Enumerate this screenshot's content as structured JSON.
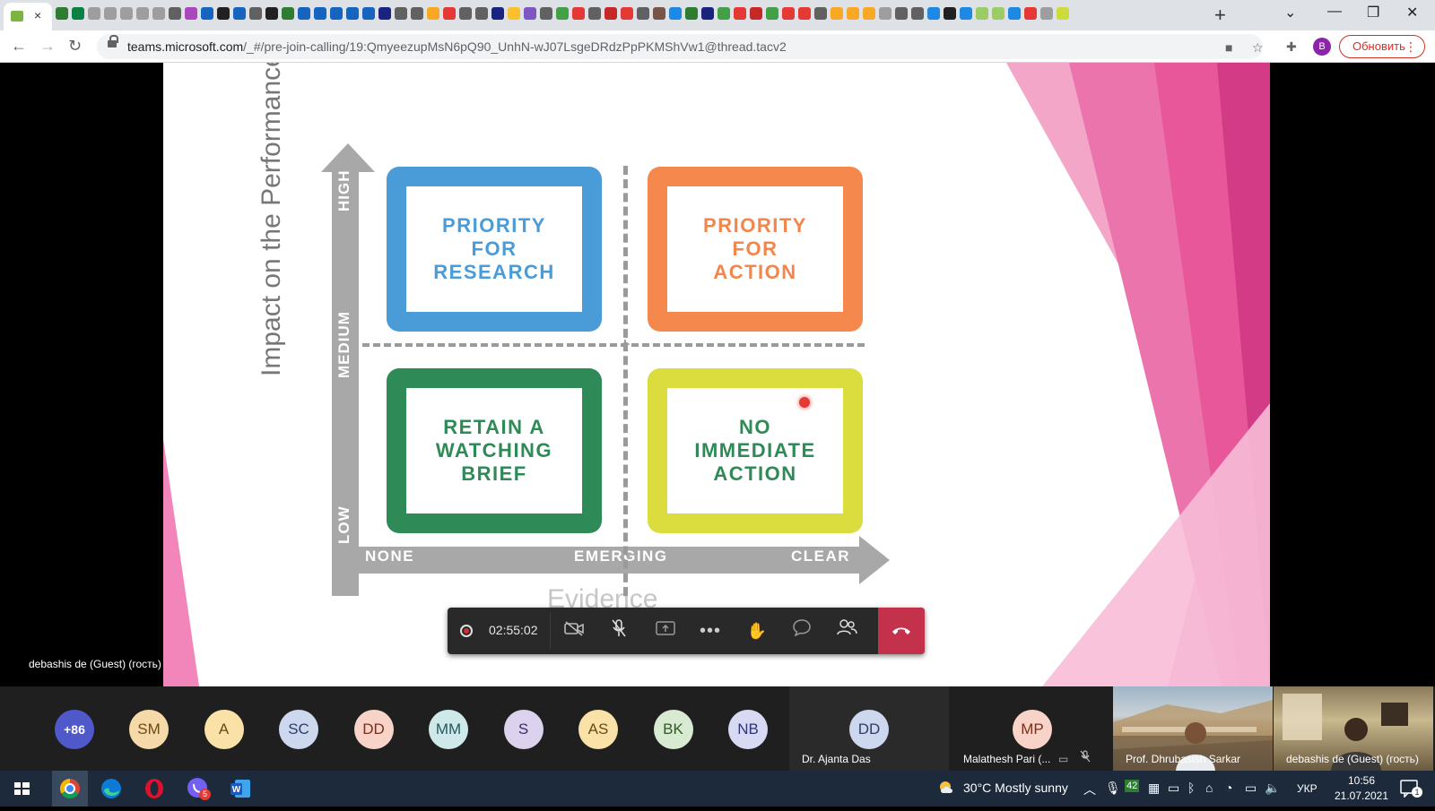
{
  "browser": {
    "close_tab_glyph": "×",
    "new_tab_glyph": "+",
    "url_host": "teams.microsoft.com",
    "url_path": "/_#/pre-join-calling/19:QmyeezupMsN6pQ90_UnhN-wJ07LsgeDRdzPpPKMShVw1@thread.tacv2",
    "profile_initial": "B",
    "update_label": "Обновить"
  },
  "slide": {
    "y_axis_title": "Impact on the Performance Gap",
    "y_ticks": [
      "HIGH",
      "MEDIUM",
      "LOW"
    ],
    "x_ticks": [
      "NONE",
      "EMERGING",
      "CLEAR"
    ],
    "x_axis_title": "Evidence",
    "quadrants": {
      "top_left": "PRIORITY\nFOR\nRESEARCH",
      "top_right": "PRIORITY\nFOR\nACTION",
      "bottom_left": "RETAIN A\nWATCHING\nBRIEF",
      "bottom_right": "NO\nIMMEDIATE\nACTION"
    },
    "colors": {
      "research": "#4a9cd8",
      "action": "#f5894d",
      "watch": "#2e8b57",
      "none": "#dbdc3e",
      "pink": "#e8579a"
    }
  },
  "presenter_label": "debashis de (Guest) (гость)",
  "call": {
    "timer": "02:55:02",
    "icons": [
      "record-icon",
      "camera-off-icon",
      "mic-off-icon",
      "share-icon",
      "more-icon",
      "raise-hand-icon",
      "chat-icon",
      "participants-icon",
      "hang-up-icon"
    ]
  },
  "participants": {
    "overflow_count": "+86",
    "avatars": [
      {
        "initials": "SM",
        "bg": "#f6d9a8",
        "fg": "#6b4a16"
      },
      {
        "initials": "A",
        "bg": "#f9e1a8",
        "fg": "#6b4a16"
      },
      {
        "initials": "SC",
        "bg": "#cdd8ee",
        "fg": "#2e3d66"
      },
      {
        "initials": "DD",
        "bg": "#f8d4c8",
        "fg": "#7a2f1e"
      },
      {
        "initials": "MM",
        "bg": "#cfe8ea",
        "fg": "#225a5e"
      },
      {
        "initials": "S",
        "bg": "#ddd2ee",
        "fg": "#3d2c66"
      },
      {
        "initials": "AS",
        "bg": "#f9e1a8",
        "fg": "#6b4a16"
      },
      {
        "initials": "BK",
        "bg": "#d9ead3",
        "fg": "#2f5a22"
      },
      {
        "initials": "NB",
        "bg": "#d7daf2",
        "fg": "#2f3578"
      }
    ],
    "named_tiles": [
      {
        "initials": "DD",
        "name": "Dr. Ajanta Das"
      },
      {
        "initials": "MP",
        "name": "Malathesh Pari (..."
      }
    ],
    "video_tiles": [
      "Prof. Dhrubasish Sarkar",
      "debashis de (Guest) (гость)"
    ]
  },
  "taskbar": {
    "weather": "30°C  Mostly sunny",
    "tray_badge": "42",
    "language": "УКР",
    "time": "10:56",
    "date": "21.07.2021",
    "notification_count": "1",
    "viber_badge": "5"
  }
}
